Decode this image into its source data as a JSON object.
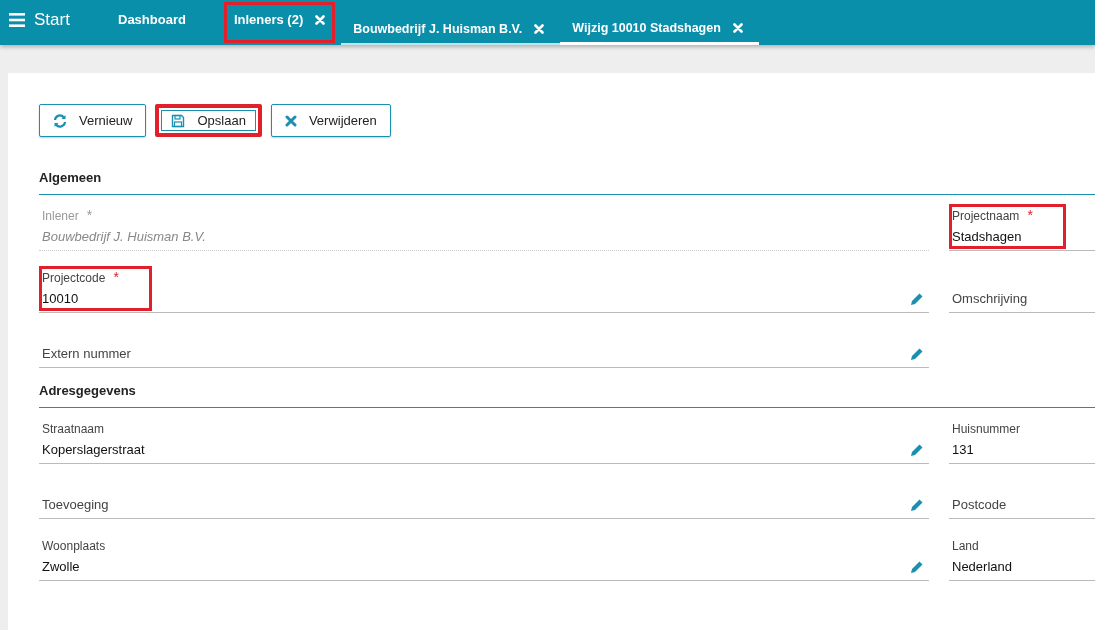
{
  "topbar": {
    "menu_label": "Start"
  },
  "tabs": [
    {
      "label": "Dashboard",
      "kind": "main",
      "closable": false,
      "selected": false,
      "highlighted": false
    },
    {
      "label": "Inleners (2)",
      "kind": "main",
      "closable": true,
      "selected": false,
      "highlighted": true
    },
    {
      "label": "Bouwbedrijf J. Huisman B.V.",
      "kind": "sub",
      "closable": true,
      "selected": false,
      "highlighted": false
    },
    {
      "label": "Wijzig 10010 Stadshagen",
      "kind": "sub",
      "closable": true,
      "selected": true,
      "highlighted": false
    }
  ],
  "toolbar": [
    {
      "label": "Vernieuw",
      "kind": "refresh",
      "highlighted": false
    },
    {
      "label": "Opslaan",
      "kind": "save",
      "highlighted": true
    },
    {
      "label": "Verwijderen",
      "kind": "delete",
      "highlighted": false
    }
  ],
  "sections": [
    {
      "title": "Algemeen",
      "rows": [
        {
          "left": {
            "label": "Inlener",
            "value": "Bouwbedrijf J. Huisman B.V.",
            "required_mark": "*",
            "disabled": true,
            "editable": false,
            "highlighted": false
          },
          "right": {
            "label": "Projectnaam",
            "value": "Stadshagen",
            "required_mark": "*",
            "disabled": false,
            "editable": false,
            "highlighted": true
          }
        },
        {
          "left": {
            "label": "Projectcode",
            "value": "10010",
            "required_mark": "*",
            "disabled": false,
            "editable": true,
            "highlighted": true
          },
          "right": {
            "label": "Omschrijving",
            "disabled": false,
            "editable": false,
            "highlighted": false
          }
        },
        {
          "left": {
            "label": "Extern nummer",
            "disabled": false,
            "editable": true,
            "highlighted": false
          }
        }
      ]
    },
    {
      "title": "Adresgegevens",
      "rows": [
        {
          "left": {
            "label": "Straatnaam",
            "value": "Koperslagerstraat",
            "disabled": false,
            "editable": true,
            "highlighted": false
          },
          "right": {
            "label": "Huisnummer",
            "value": "131",
            "disabled": false,
            "editable": false,
            "highlighted": false
          }
        },
        {
          "left": {
            "label": "Toevoeging",
            "disabled": false,
            "editable": true,
            "highlighted": false
          },
          "right": {
            "label": "Postcode",
            "disabled": false,
            "editable": false,
            "highlighted": false
          }
        },
        {
          "left": {
            "label": "Woonplaats",
            "value": "Zwolle",
            "disabled": false,
            "editable": true,
            "highlighted": false
          },
          "right": {
            "label": "Land",
            "value": "Nederland",
            "disabled": false,
            "editable": false,
            "highlighted": false
          }
        }
      ]
    }
  ]
}
